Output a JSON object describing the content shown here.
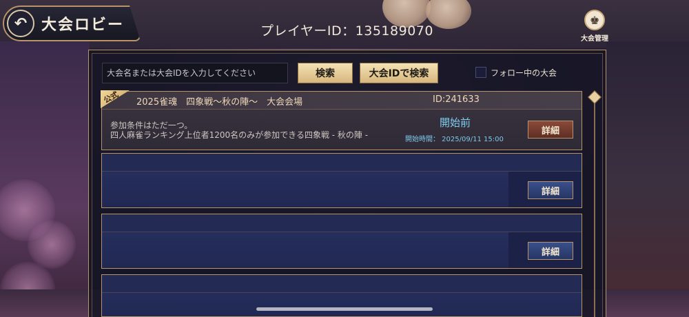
{
  "header": {
    "back_label": "大会ロビー",
    "back_glyph": "↶",
    "player_id_text": "プレイヤーID：135189070",
    "admin_label": "大会管理",
    "admin_glyph": "♚"
  },
  "search": {
    "placeholder": "大会名または大会IDを入力してください",
    "search_button": "検索",
    "id_search_button": "大会IDで検索",
    "follow_label": "フォロー中の大会",
    "follow_checked": false
  },
  "tournaments": [
    {
      "badge": "公式",
      "title": "2025雀魂　四象戦～秋の陣～　大会会場",
      "id_text": "ID:241633",
      "desc_line1": "参加条件はただ一つ。",
      "desc_line2": "四人麻雀ランキング上位者1200名のみが参加できる四象戦 - 秋の陣 -",
      "status": "開始前",
      "start_time": "開始時間：  2025/09/11 15:00",
      "detail_button": "詳細"
    },
    {
      "detail_button": "詳細"
    },
    {
      "detail_button": "詳細"
    }
  ],
  "colors": {
    "gold_border": "#b8946a",
    "status_blue": "#7fd0f0",
    "card_blue": "#283262"
  }
}
